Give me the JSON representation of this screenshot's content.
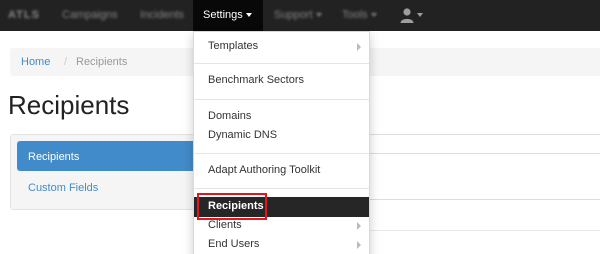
{
  "navbar": {
    "brand": "ATLS",
    "items": [
      {
        "label": "Campaigns"
      },
      {
        "label": "Incidents"
      },
      {
        "label": "Settings"
      },
      {
        "label": "Support"
      },
      {
        "label": "Tools"
      }
    ],
    "user_icon": "user-icon"
  },
  "breadcrumb": {
    "home": "Home",
    "separator": "/",
    "current": "Recipients"
  },
  "page": {
    "title": "Recipients"
  },
  "sidebar": {
    "items": [
      {
        "label": "Recipients",
        "active": true
      },
      {
        "label": "Custom Fields",
        "active": false
      }
    ]
  },
  "settings_menu": {
    "items": [
      {
        "label": "Templates",
        "submenu": true
      },
      {
        "label": "Benchmark Sectors",
        "submenu": false
      },
      {
        "label": "Domains",
        "submenu": false
      },
      {
        "label": "Dynamic DNS",
        "submenu": false
      },
      {
        "label": "Adapt Authoring Toolkit",
        "submenu": false
      },
      {
        "label": "Recipients",
        "submenu": false,
        "active": true
      },
      {
        "label": "Clients",
        "submenu": true
      },
      {
        "label": "End Users",
        "submenu": true
      }
    ]
  },
  "colors": {
    "navbar_bg": "#222222",
    "link": "#428bca",
    "active_bg": "#428bca",
    "menu_active_bg": "#262626",
    "highlight": "#e8141d"
  }
}
